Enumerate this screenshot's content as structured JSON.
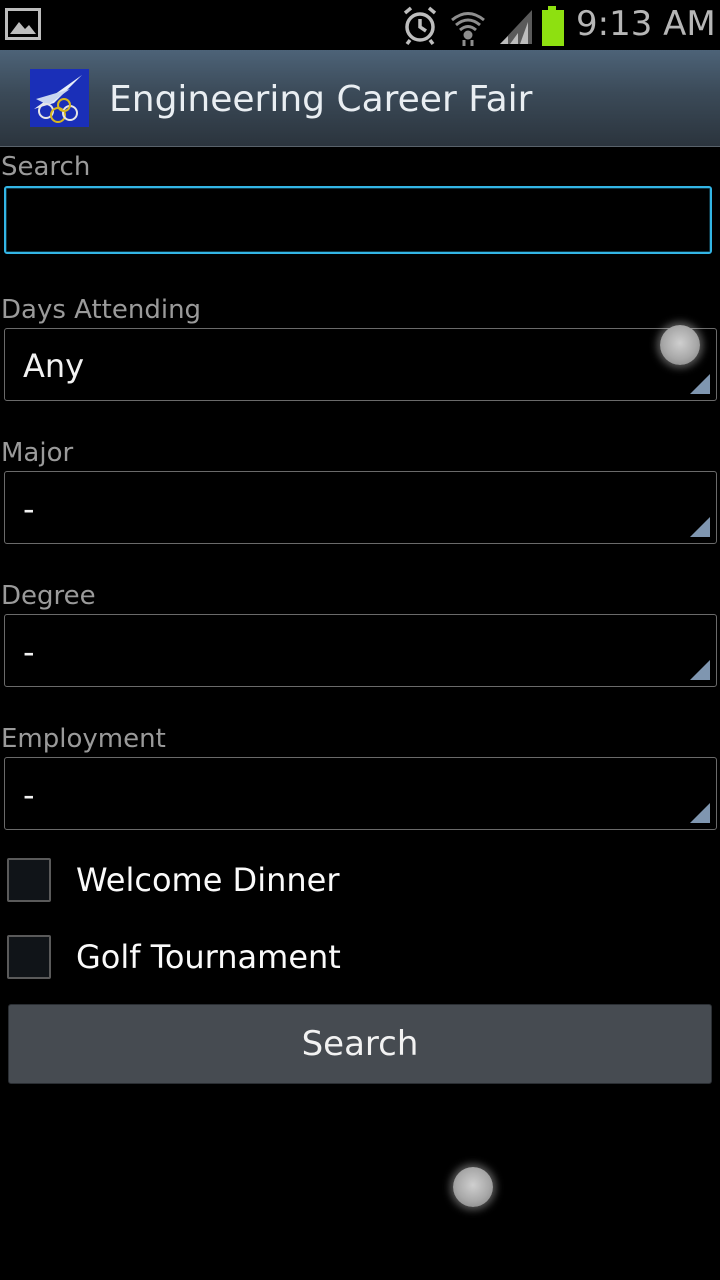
{
  "status_bar": {
    "time": "9:13 AM",
    "icons": [
      "gallery-icon",
      "alarm-icon",
      "wifi-icon",
      "signal-icon",
      "battery-icon"
    ],
    "battery_color": "#8ee010"
  },
  "action_bar": {
    "title": "Engineering Career Fair",
    "logo_icon": "app-logo-icon"
  },
  "form": {
    "search": {
      "label": "Search",
      "value": "",
      "placeholder": ""
    },
    "days_attending": {
      "label": "Days Attending",
      "selected": "Any"
    },
    "major": {
      "label": "Major",
      "selected": "-"
    },
    "degree": {
      "label": "Degree",
      "selected": "-"
    },
    "employment": {
      "label": "Employment",
      "selected": "-"
    },
    "checkboxes": [
      {
        "label": "Welcome Dinner",
        "checked": false
      },
      {
        "label": "Golf Tournament",
        "checked": false
      }
    ],
    "submit_label": "Search"
  },
  "colors": {
    "accent": "#33b5e5",
    "spinner_arrow": "#7f96b0",
    "button_bg": "#464b51"
  }
}
